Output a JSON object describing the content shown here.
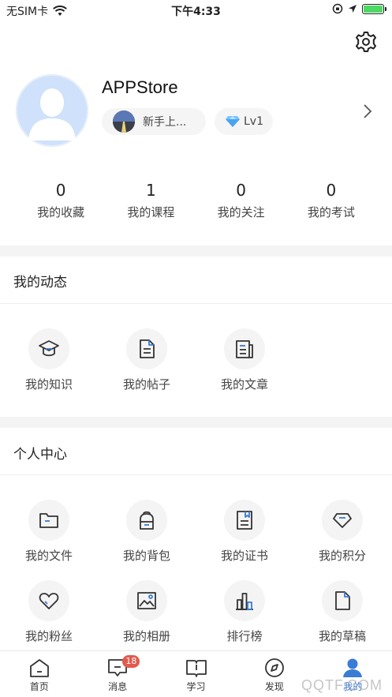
{
  "status_bar": {
    "carrier": "无SIM卡",
    "time": "下午4:33"
  },
  "profile": {
    "username": "APPStore",
    "rank_label": "新手上...",
    "level_label": "Lv1"
  },
  "stats": [
    {
      "value": "0",
      "label": "我的收藏"
    },
    {
      "value": "1",
      "label": "我的课程"
    },
    {
      "value": "0",
      "label": "我的关注"
    },
    {
      "value": "0",
      "label": "我的考试"
    }
  ],
  "dynamics": {
    "title": "我的动态",
    "items": [
      {
        "label": "我的知识",
        "icon": "graduation-cap-icon"
      },
      {
        "label": "我的帖子",
        "icon": "document-icon"
      },
      {
        "label": "我的文章",
        "icon": "article-icon"
      }
    ]
  },
  "personal": {
    "title": "个人中心",
    "items": [
      {
        "label": "我的文件",
        "icon": "folder-icon"
      },
      {
        "label": "我的背包",
        "icon": "backpack-icon"
      },
      {
        "label": "我的证书",
        "icon": "certificate-icon"
      },
      {
        "label": "我的积分",
        "icon": "diamond-icon"
      },
      {
        "label": "我的粉丝",
        "icon": "heart-icon"
      },
      {
        "label": "我的相册",
        "icon": "photo-icon"
      },
      {
        "label": "排行榜",
        "icon": "ranking-icon"
      },
      {
        "label": "我的草稿",
        "icon": "draft-icon"
      }
    ]
  },
  "tabs": [
    {
      "label": "首页",
      "icon": "home-icon"
    },
    {
      "label": "消息",
      "icon": "message-icon",
      "badge": "18"
    },
    {
      "label": "学习",
      "icon": "book-icon"
    },
    {
      "label": "发现",
      "icon": "compass-icon"
    },
    {
      "label": "我的",
      "icon": "user-icon",
      "active": true
    }
  ],
  "watermark": "QQTF.COM",
  "colors": {
    "accent": "#3a7bd5",
    "badge": "#e15b4e",
    "band": "#f4f4f4"
  }
}
